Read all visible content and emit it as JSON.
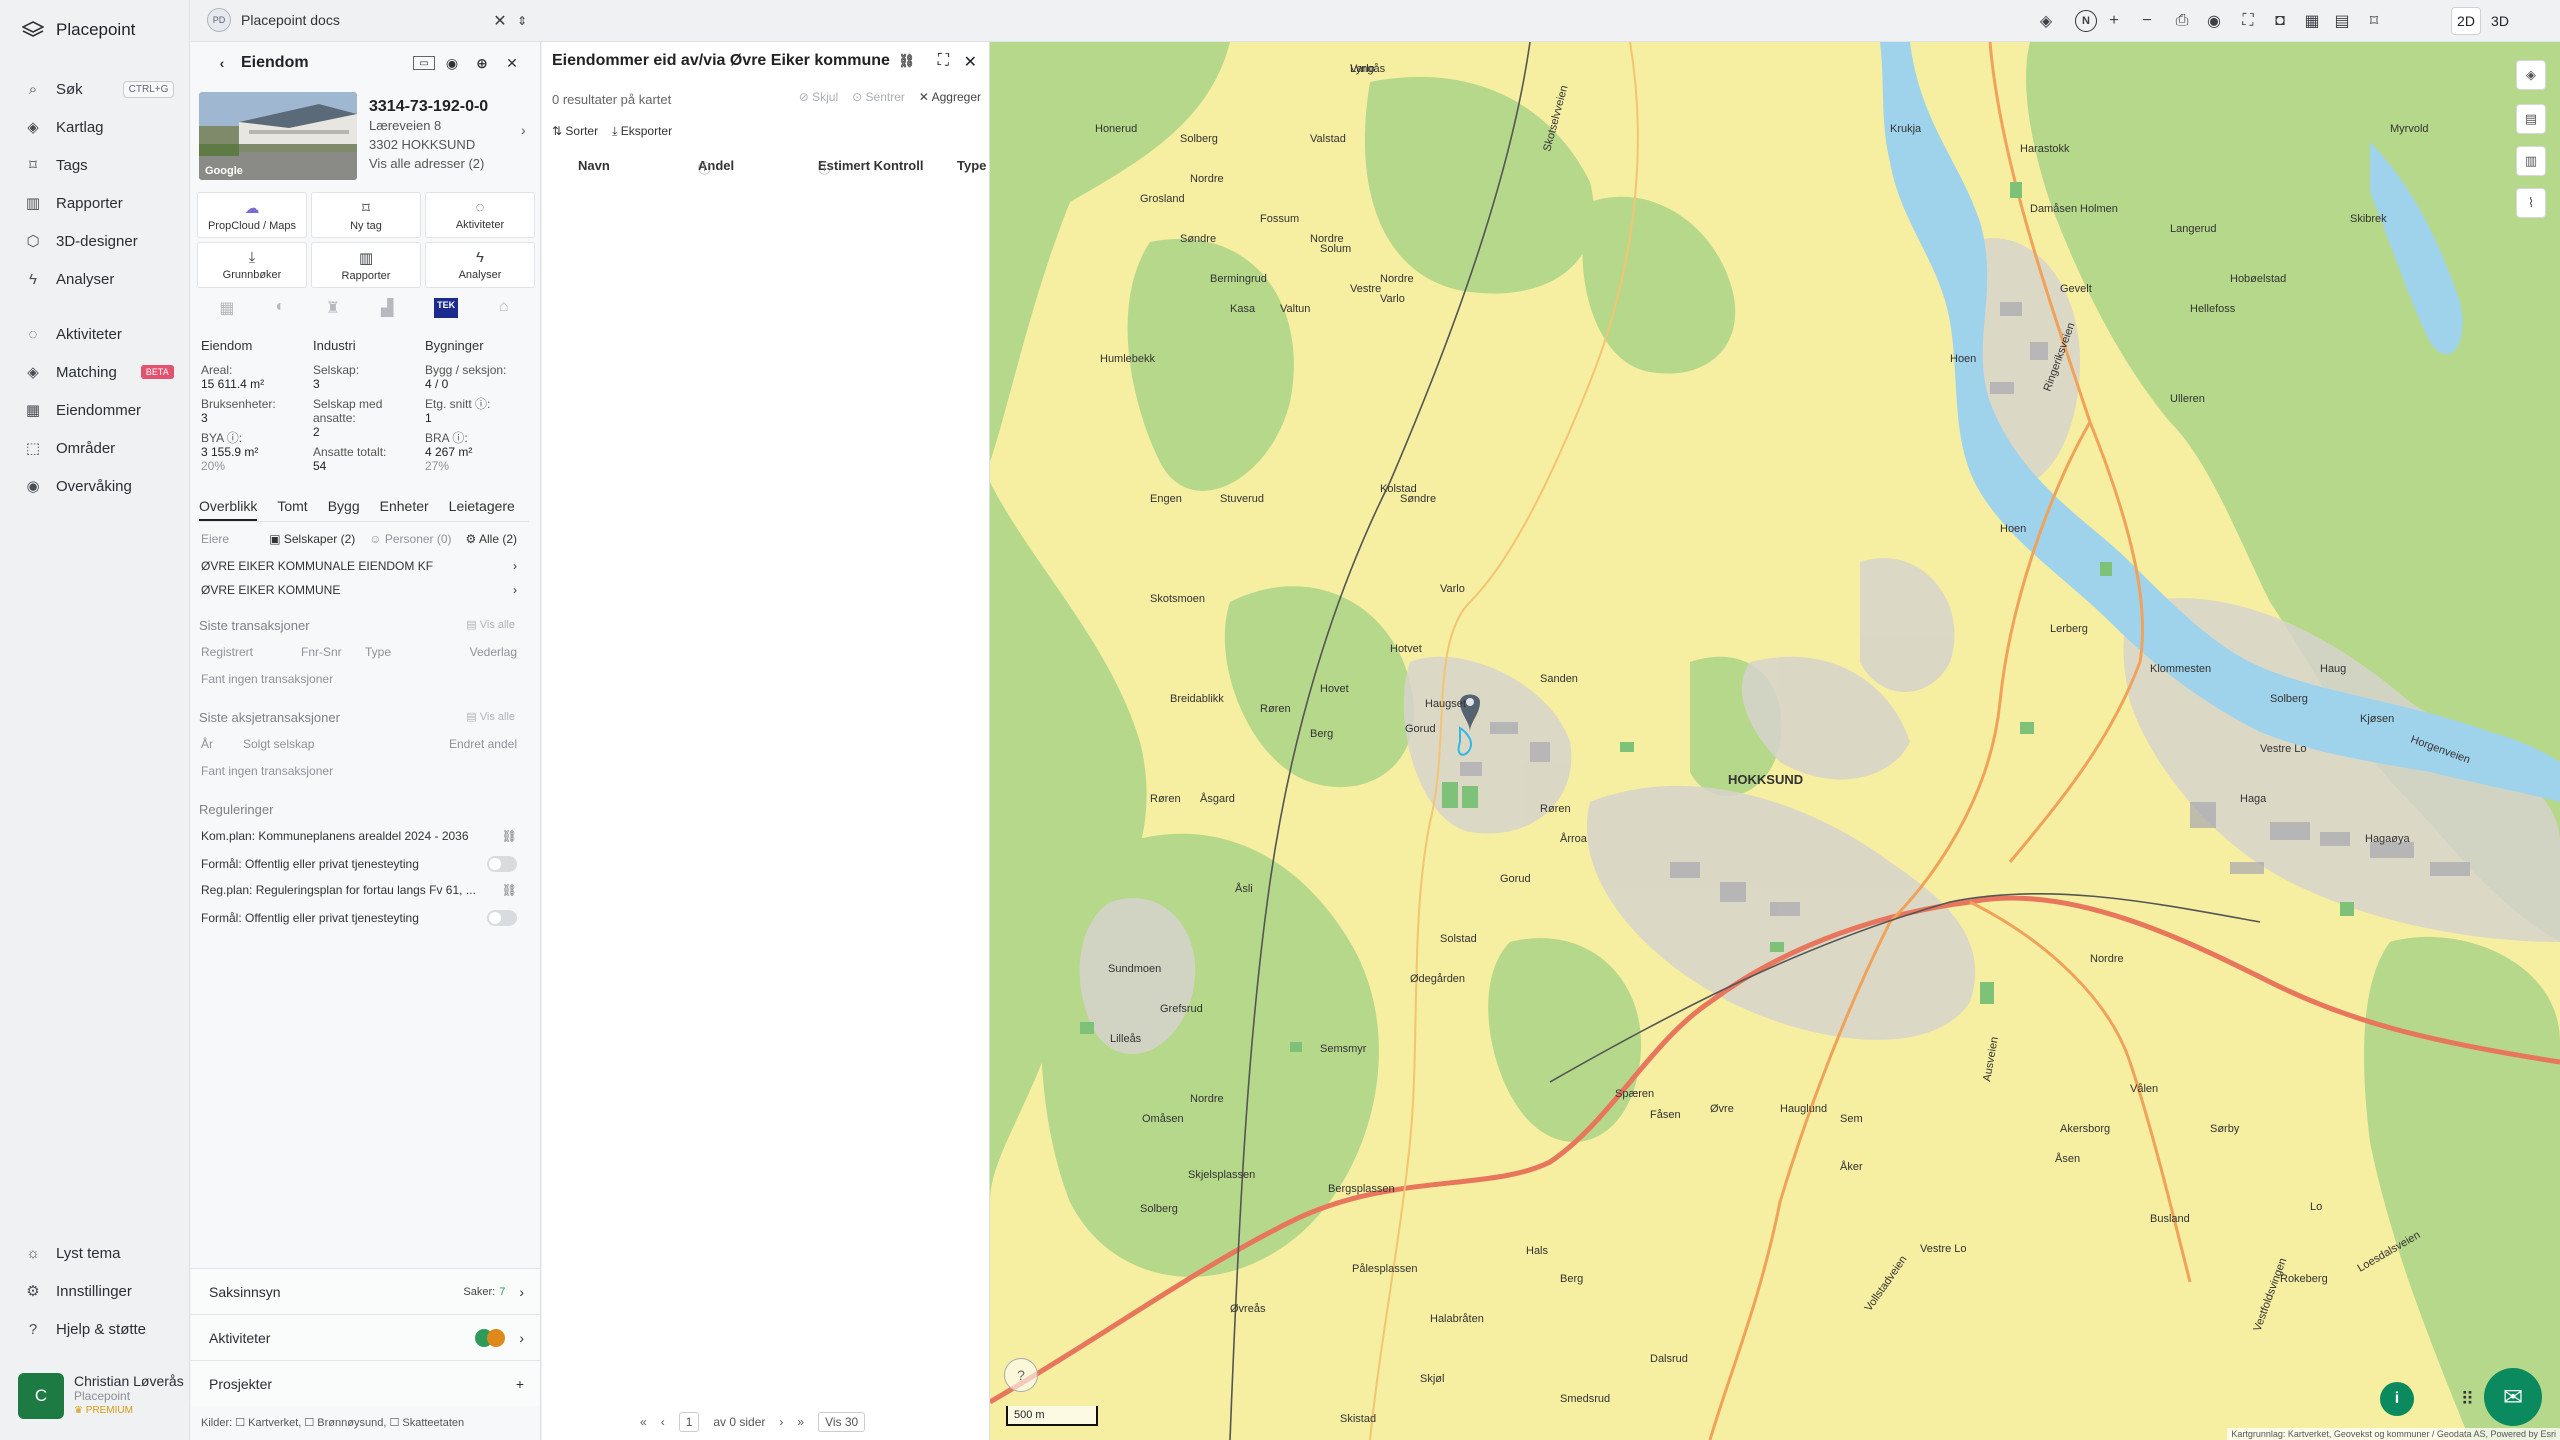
{
  "app": {
    "brand": "Placepoint"
  },
  "nav": {
    "items": [
      {
        "label": "Søk",
        "icon": "search-icon"
      },
      {
        "label": "Kartlag",
        "icon": "layers-icon"
      },
      {
        "label": "Tags",
        "icon": "bookmark-icon"
      },
      {
        "label": "Rapporter",
        "icon": "chart-icon"
      },
      {
        "label": "3D-designer",
        "icon": "cube-icon"
      },
      {
        "label": "Analyser",
        "icon": "bolt-icon"
      },
      {
        "label": "Aktiviteter",
        "icon": "chat-icon"
      },
      {
        "label": "Matching",
        "icon": "layers-icon"
      },
      {
        "label": "Eiendommer",
        "icon": "table-icon"
      },
      {
        "label": "Områder",
        "icon": "area-icon"
      },
      {
        "label": "Overvåking",
        "icon": "eye-icon"
      }
    ],
    "search_shortcut": "CTRL+G",
    "matching_badge": "BETA",
    "bottom": [
      {
        "label": "Lyst tema",
        "icon": "sun-icon"
      },
      {
        "label": "Innstillinger",
        "icon": "gear-icon"
      },
      {
        "label": "Hjelp & støtte",
        "icon": "help-icon"
      }
    ],
    "user": {
      "initial": "C",
      "name": "Christian Løverås",
      "org": "Placepoint",
      "plan": "PREMIUM"
    }
  },
  "topbar": {
    "doc_badge": "PD",
    "doc_title": "Placepoint docs",
    "mode_2d": "2D",
    "mode_3d": "3D",
    "compass": "N"
  },
  "property": {
    "header": "Eiendom",
    "photo_credit": "Google",
    "gnr": "3314-73-192-0-0",
    "street": "Læreveien 8",
    "postal": "3302 HOKKSUND",
    "all_addresses": "Vis alle adresser (2)",
    "tiles": [
      "PropCloud / Maps",
      "Ny tag",
      "Aktiviteter",
      "Grunnbøker",
      "Rapporter",
      "Analyser"
    ],
    "tek_label": "TEK",
    "stats": {
      "eiendom": {
        "title": "Eiendom",
        "areal_label": "Areal:",
        "areal_value": "15 611.4 m²",
        "bruks_label": "Bruksenheter:",
        "bruks_value": "3",
        "bya_label": "BYA ⓘ:",
        "bya_value": "3 155.9 m²",
        "bya_pct": "20%"
      },
      "industri": {
        "title": "Industri",
        "selskap_label": "Selskap:",
        "selskap_value": "3",
        "ansatte_label": "Selskap med ansatte:",
        "ansatte_value": "2",
        "totalt_label": "Ansatte totalt:",
        "totalt_value": "54"
      },
      "bygninger": {
        "title": "Bygninger",
        "bygg_label": "Bygg / seksjon:",
        "bygg_value": "4 / 0",
        "etg_label": "Etg. snitt ⓘ:",
        "etg_value": "1",
        "bra_label": "BRA ⓘ:",
        "bra_value": "4 267 m²",
        "bra_pct": "27%"
      }
    },
    "subtabs": [
      "Overblikk",
      "Tomt",
      "Bygg",
      "Enheter",
      "Leietagere"
    ],
    "owners": {
      "label": "Eiere",
      "selskaper": "Selskaper (2)",
      "personer": "Personer (0)",
      "alle": "Alle (2)",
      "list": [
        "ØVRE EIKER KOMMUNALE EIENDOM KF",
        "ØVRE EIKER KOMMUNE"
      ]
    },
    "transactions": {
      "title": "Siste transaksjoner",
      "show_all": "Vis alle",
      "cols": [
        "Registrert",
        "Fnr-Snr",
        "Type",
        "Vederlag"
      ],
      "empty": "Fant ingen transaksjoner"
    },
    "share_transactions": {
      "title": "Siste aksjetransaksjoner",
      "show_all": "Vis alle",
      "cols": [
        "År",
        "Solgt selskap",
        "Endret andel"
      ],
      "empty": "Fant ingen transaksjoner"
    },
    "regulations": {
      "title": "Reguleringer",
      "items": [
        {
          "text": "Kom.plan: Kommuneplanens arealdel 2024 - 2036",
          "kind": "link"
        },
        {
          "text": "Formål: Offentlig eller privat tjenesteyting",
          "kind": "toggle"
        },
        {
          "text": "Reg.plan: Reguleringsplan for fortau langs Fv 61, ...",
          "kind": "link"
        },
        {
          "text": "Formål: Offentlig eller privat tjenesteyting",
          "kind": "toggle"
        }
      ]
    },
    "cards": [
      {
        "label": "Saksinnsyn",
        "extra": "Saker:",
        "count": "7"
      },
      {
        "label": "Aktiviteter",
        "extra": "",
        "count": ""
      },
      {
        "label": "Prosjekter",
        "extra": "",
        "count": "+"
      }
    ],
    "kilder": "Kilder: ☐ Kartverket, ☐ Brønnøysund, ☐ Skatteetaten"
  },
  "ownership": {
    "title": "Eiendommer eid av/via Øvre Eiker kommune",
    "count": "0 resultater på kartet",
    "actions": [
      "Skjul",
      "Sentrer",
      "Aggreger"
    ],
    "tools": [
      "Sorter",
      "Eksporter"
    ],
    "columns": [
      "Navn",
      "Andel",
      "Estimert Kontroll",
      "Type"
    ],
    "pager": {
      "page": "1",
      "of": "av 0 sider",
      "per_page": "Vis 30"
    }
  },
  "map": {
    "town": "HOKKSUND",
    "scale": "500 m",
    "attribution": "Kartgrunnlag: Kartverket, Geovekst og kommuner / Geodata AS, Powered by Esri",
    "places": [
      "Lyngås",
      "Solberg",
      "Valstad",
      "Honerud",
      "Nordre",
      "Grosland",
      "Søndre",
      "Fossum",
      "Nordre",
      "Solum",
      "Vestre",
      "Kasa",
      "Bermingrud",
      "Valtun",
      "Nordre",
      "Varlo",
      "Humlebekk",
      "Engen",
      "Stuverud",
      "Kolstad",
      "Skotsmoen",
      "Søndre",
      "Varlo",
      "Hotvet",
      "Breidablikk",
      "Røren",
      "Hovet",
      "Berg",
      "Haugset",
      "Gorud",
      "Røren",
      "Åsgard",
      "Røren",
      "Årroa",
      "Åsli",
      "Gorud",
      "Solstad",
      "Sundmoen",
      "Grefsrud",
      "Semsmyr",
      "Ødegården",
      "Lilleås",
      "Nordre",
      "Omåsen",
      "Skjelsplassen",
      "Solberg",
      "Øvreås",
      "Bergsplassen",
      "Halabråten",
      "Pålesplassen",
      "Hals",
      "Skjøl",
      "Berg",
      "Spæren",
      "Øvre",
      "Fåsen",
      "Sem",
      "Åker",
      "Akersborg",
      "Hauglund",
      "Busland",
      "Vestre Lo",
      "Lo",
      "Skistad",
      "Smedsrud",
      "Dalsrud",
      "Vålen",
      "Rokeberg",
      "Sørby",
      "Kjøsen",
      "Vestre Lo",
      "Solberg",
      "Klommesten",
      "Sanden",
      "Lerberg",
      "Hoen",
      "Hoen",
      "Hellefoss",
      "Hobøelstad",
      "Ulleren",
      "Damåsen",
      "Harastokk",
      "Langerud",
      "Skibrek",
      "Gevelt",
      "Krukja",
      "Nordre",
      "Haga",
      "Haug",
      "Hagaøya",
      "Åsen",
      "Myrvold",
      "Holmen",
      "Varlo"
    ],
    "roads": [
      "Ringeriksveien",
      "Skotselvveien",
      "Loesdalsveien",
      "Horgenveien",
      "Vollstadveien",
      "Ausveien",
      "Vestfoldsvingen"
    ]
  }
}
